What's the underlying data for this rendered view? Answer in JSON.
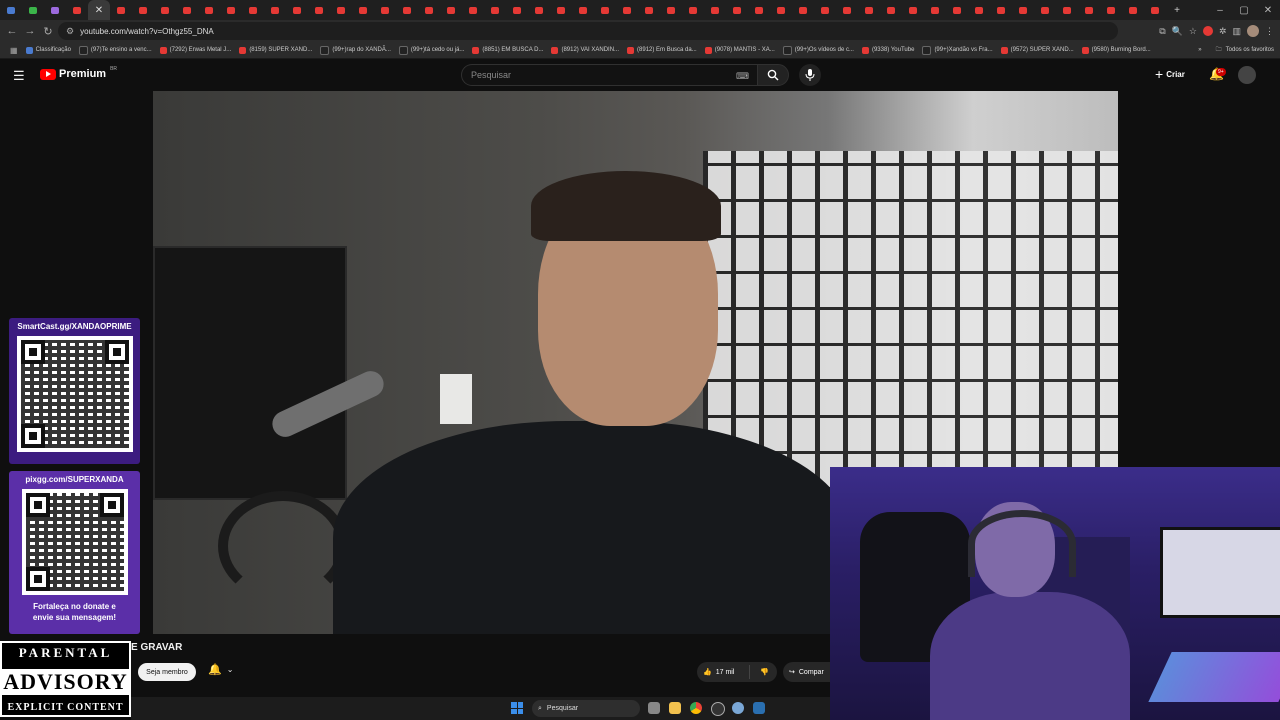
{
  "browser": {
    "url": "youtube.com/watch?v=Othgz55_DNA",
    "tab_count": 53,
    "bookmarks": [
      {
        "label": "Classificação",
        "icon": "blue"
      },
      {
        "label": "(97)Te ensino a venc...",
        "icon": "tiktok"
      },
      {
        "label": "(7292) Erwas Metal J...",
        "icon": "youtube"
      },
      {
        "label": "(8159) SUPER XAND...",
        "icon": "youtube"
      },
      {
        "label": "(99+)rap do XANDÃ...",
        "icon": "tiktok"
      },
      {
        "label": "(99+)tá cedo ou já...",
        "icon": "tiktok"
      },
      {
        "label": "(8851) EM BUSCA D...",
        "icon": "youtube"
      },
      {
        "label": "(8912) VAI XANDIN...",
        "icon": "youtube"
      },
      {
        "label": "(8912) Em Busca da...",
        "icon": "youtube"
      },
      {
        "label": "(9078) MANTIS - XA...",
        "icon": "youtube"
      },
      {
        "label": "(99+)Os vídeos de c...",
        "icon": "tiktok"
      },
      {
        "label": "(9338) YouTube",
        "icon": "youtube"
      },
      {
        "label": "(99+)Xandão vs Fra...",
        "icon": "tiktok"
      },
      {
        "label": "(9572) SUPER XAND...",
        "icon": "youtube"
      },
      {
        "label": "(9580) Burning Bord...",
        "icon": "youtube"
      }
    ],
    "all_bookmarks_label": "Todos os favoritos"
  },
  "youtube": {
    "logo_text": "Premium",
    "logo_region": "BR",
    "search_placeholder": "Pesquisar",
    "create_label": "Criar",
    "notification_badge": "9+",
    "video_title_fragment": "E GRAVAR",
    "member_button": "Seja membro",
    "like_count": "17 mil",
    "share_label": "Compar"
  },
  "overlays": {
    "qr1_label": "SmartCast.gg/XANDAOPRIME",
    "qr2_label": "pixgg.com/SUPERXANDA",
    "qr2_caption_line1": "Fortaleça no donate e",
    "qr2_caption_line2": "envie sua mensagem!",
    "advisory_line1": "PARENTAL",
    "advisory_line2": "ADVISORY",
    "advisory_line3": "EXPLICIT CONTENT"
  },
  "taskbar": {
    "search_label": "Pesquisar"
  },
  "colors": {
    "youtube_red": "#ff0000",
    "qr_panel_purple": "#5b2fa8",
    "webcam_glow": "#3b2d8a"
  }
}
